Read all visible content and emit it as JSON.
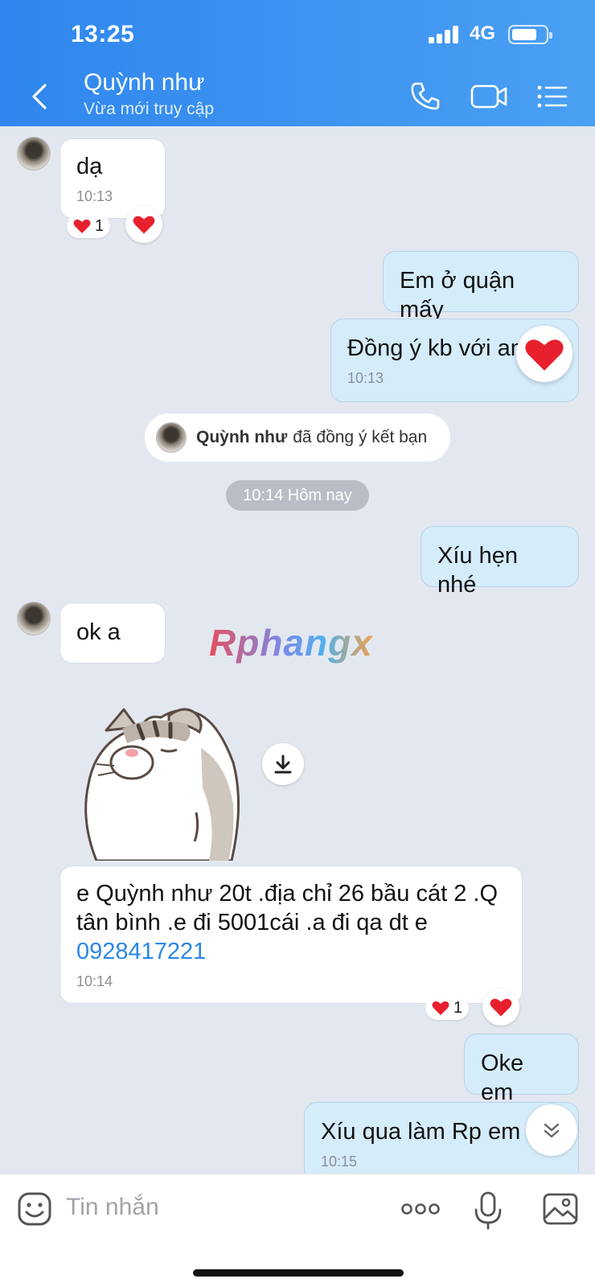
{
  "status_bar": {
    "time": "13:25",
    "network": "4G"
  },
  "header": {
    "contact_name": "Quỳnh như",
    "contact_status": "Vừa mới truy cập"
  },
  "messages": [
    {
      "side": "in",
      "text": "dạ",
      "time": "10:13",
      "reaction_count": "1"
    },
    {
      "side": "out",
      "text": "Em ở quận mấy"
    },
    {
      "side": "out",
      "text": "Đồng ý kb với an",
      "time": "10:13"
    },
    {
      "side": "out",
      "text": "Xíu hẹn nhé"
    },
    {
      "side": "in",
      "text": "ok a"
    },
    {
      "side": "in",
      "text_lines": [
        "e Quỳnh như 20t .địa chỉ 26 bầu cát 2 .Q",
        "tân bình .e đi 5001cái .a đi qa dt e"
      ],
      "phone": "0928417221",
      "time": "10:14",
      "reaction_count": "1"
    },
    {
      "side": "out",
      "text": "Oke em"
    },
    {
      "side": "out",
      "text": "Xíu qua làm Rp em n",
      "time": "10:15"
    }
  ],
  "system_notice": {
    "name": "Quỳnh như",
    "text": "đã đồng ý kết bạn"
  },
  "date_separator": "10:14 Hôm nay",
  "watermark": "Rphangx",
  "composer": {
    "placeholder": "Tin nhắn"
  },
  "colors": {
    "header": "#2f86ee",
    "outgoing_bubble": "#d5ecfb",
    "incoming_bubble": "#ffffff",
    "background": "#e3e8f0",
    "link": "#2b87e6",
    "heart": "#e8202e"
  }
}
